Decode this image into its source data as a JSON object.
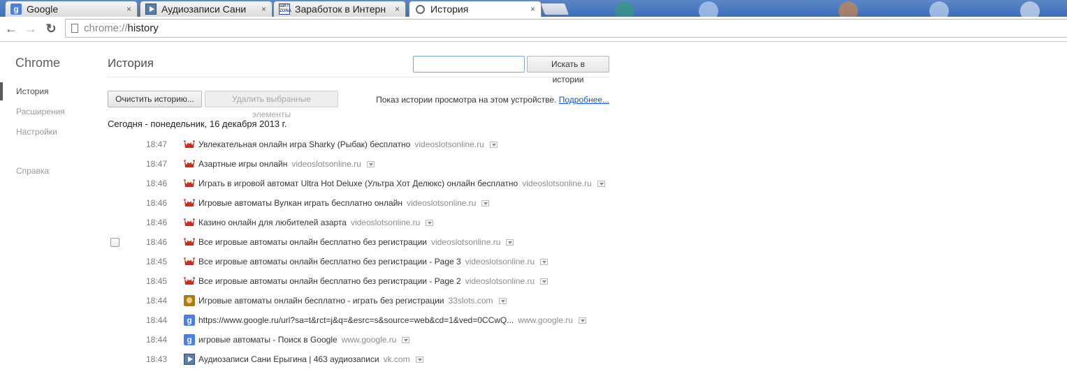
{
  "tabs": [
    {
      "label": "Google",
      "icon": "google-icon"
    },
    {
      "label": "Аудиозаписи Сани",
      "icon": "vk-audio-icon"
    },
    {
      "label": "Заработок в Интерн",
      "icon": "zona-icon"
    },
    {
      "label": "История",
      "icon": "history-icon",
      "active": true
    }
  ],
  "tab_close": "×",
  "toolbar": {
    "back": "←",
    "forward": "→",
    "reload": "↻",
    "url_scheme": "chrome://",
    "url_host": "history"
  },
  "sidebar": {
    "brand": "Chrome",
    "items": [
      {
        "label": "История",
        "selected": true
      },
      {
        "label": "Расширения"
      },
      {
        "label": "Настройки"
      },
      {
        "label": "Справка"
      }
    ]
  },
  "main": {
    "title": "История",
    "search": {
      "value": "",
      "button": "Искать в истории"
    },
    "clear_button": "Очистить историю...",
    "remove_button": "Удалить выбранные элементы",
    "device_note": "Показ истории просмотра на этом устройстве.",
    "more_link": "Подробнее...",
    "day_header": "Сегодня - понедельник, 16 декабря 2013 г."
  },
  "history": [
    {
      "time": "18:47",
      "icon": "crown-icon",
      "title": "Увлекательная онлайн игра Sharky (Рыбак) бесплатно",
      "domain": "videoslotsonline.ru"
    },
    {
      "time": "18:47",
      "icon": "crown-icon",
      "title": "Азартные игры онлайн",
      "domain": "videoslotsonline.ru"
    },
    {
      "time": "18:46",
      "icon": "crown-icon",
      "title": "Играть в игровой автомат Ultra Hot Deluxe (Ультра Хот Делюкс) онлайн бесплатно",
      "domain": "videoslotsonline.ru"
    },
    {
      "time": "18:46",
      "icon": "crown-icon",
      "title": "Игровые автоматы Вулкан играть бесплатно онлайн",
      "domain": "videoslotsonline.ru"
    },
    {
      "time": "18:46",
      "icon": "crown-icon",
      "title": "Казино онлайн для любителей азарта",
      "domain": "videoslotsonline.ru"
    },
    {
      "time": "18:46",
      "icon": "crown-icon",
      "title": "Все игровые автоматы онлайн бесплатно без регистрации",
      "domain": "videoslotsonline.ru",
      "checkbox": true
    },
    {
      "time": "18:45",
      "icon": "crown-icon",
      "title": "Все игровые автоматы онлайн бесплатно без регистрации - Page 3",
      "domain": "videoslotsonline.ru"
    },
    {
      "time": "18:45",
      "icon": "crown-icon",
      "title": "Все игровые автоматы онлайн бесплатно без регистрации - Page 2",
      "domain": "videoslotsonline.ru"
    },
    {
      "time": "18:44",
      "icon": "33slots-icon",
      "title": "Игровые автоматы онлайн бесплатно - играть без регистрации",
      "domain": "33slots.com"
    },
    {
      "time": "18:44",
      "icon": "google-icon",
      "title": "https://www.google.ru/url?sa=t&rct=j&q=&esrc=s&source=web&cd=1&ved=0CCwQ...",
      "domain": "www.google.ru"
    },
    {
      "time": "18:44",
      "icon": "google-icon",
      "title": "игровые автоматы - Поиск в Google",
      "domain": "www.google.ru"
    },
    {
      "time": "18:43",
      "icon": "vk-audio-icon",
      "title": "Аудиозаписи Сани Ерыгина | 463 аудиозаписи",
      "domain": "vk.com"
    }
  ],
  "colors": {
    "accent": "#1155cc",
    "selection": "#5a5a5a",
    "tabstrip": "#4a7bc0"
  }
}
